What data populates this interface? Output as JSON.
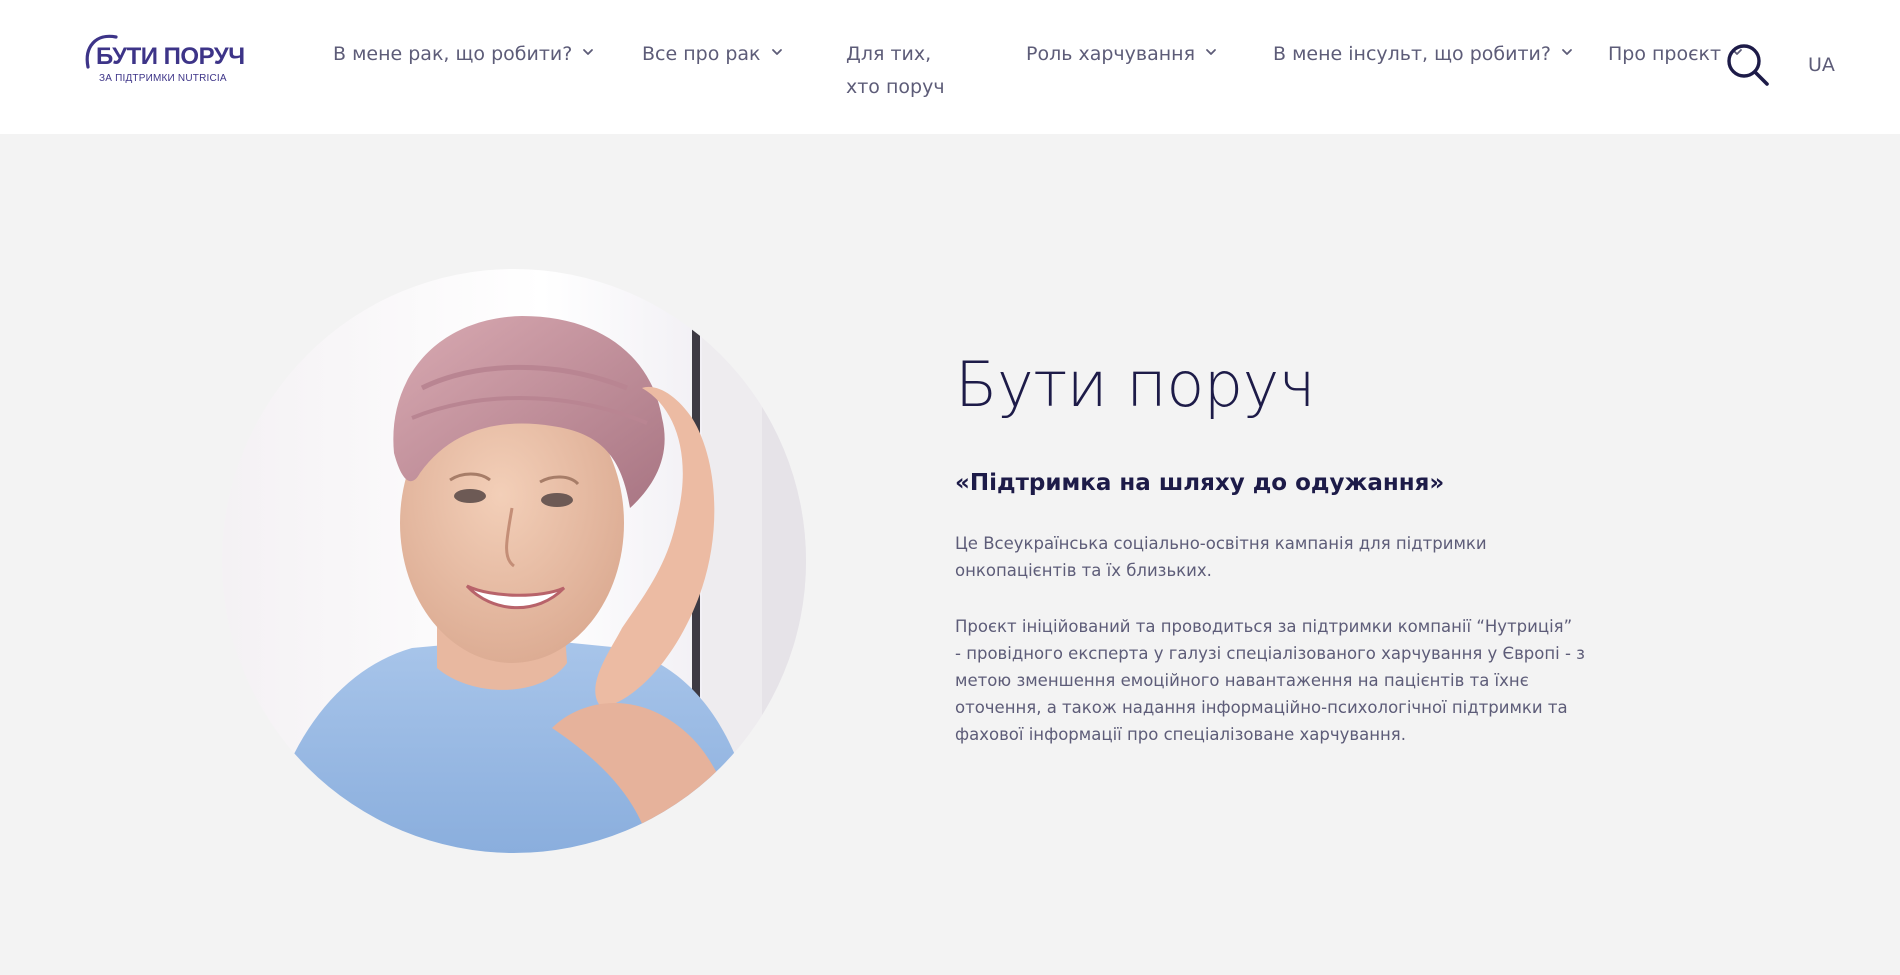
{
  "header": {
    "logo": {
      "title": "БУТИ ПОРУЧ",
      "subtitle": "ЗА ПІДТРИМКИ NUTRICIA"
    },
    "nav": [
      {
        "label": "В мене рак, що робити?",
        "has_dropdown": true
      },
      {
        "label": "Все про рак",
        "has_dropdown": true
      },
      {
        "label": "Для тих, хто поруч",
        "has_dropdown": false
      },
      {
        "label": "Роль харчування",
        "has_dropdown": true
      },
      {
        "label": "В мене інсульт, що робити?",
        "has_dropdown": true
      },
      {
        "label": "Про проєкт",
        "has_dropdown": true
      }
    ],
    "search_icon": "search-icon",
    "language": "UA"
  },
  "hero": {
    "title": "Бути поруч",
    "subtitle": "«Підтримка на шляху до одужання»",
    "paragraph1": "Це Всеукраїнська соціально-освітня кампанія для підтримки онкопацієнтів та їх близьких.",
    "paragraph2": "Проєкт ініційований та проводиться за підтримки компанії “Нутриція”\n- провідного експерта у галузі спеціалізованого харчування у Європі - з метою зменшення емоційного навантаження на пацієнтів та їхнє оточення, а також надання інформаційно-психологічної підтримки та фахової інформації про спеціалізоване харчування."
  },
  "colors": {
    "brand": "#3d3488",
    "heading": "#1d1b48",
    "body_text": "#5d5c78",
    "page_bg": "#f3f3f3",
    "header_bg": "#ffffff"
  }
}
